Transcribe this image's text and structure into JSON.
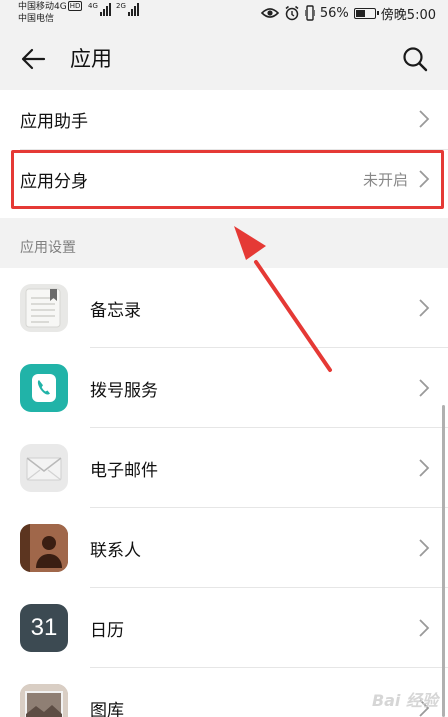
{
  "status_bar": {
    "carrier1": "中国移动4G",
    "carrier1_badge": "HD",
    "carrier2": "中国电信",
    "sig1_label": "4G",
    "sig2_label": "2G",
    "battery": "56%",
    "battery_level": 0.56,
    "time": "傍晚5:00"
  },
  "header": {
    "title": "应用"
  },
  "top_items": [
    {
      "label": "应用助手"
    },
    {
      "label": "应用分身",
      "value": "未开启"
    }
  ],
  "section_title": "应用设置",
  "apps": [
    {
      "label": "备忘录",
      "icon": "notepad-icon"
    },
    {
      "label": "拨号服务",
      "icon": "phone-icon"
    },
    {
      "label": "电子邮件",
      "icon": "mail-icon"
    },
    {
      "label": "联系人",
      "icon": "contact-icon"
    },
    {
      "label": "日历",
      "icon": "calendar-icon",
      "icon_text": "31"
    },
    {
      "label": "图库",
      "icon": "gallery-icon"
    }
  ],
  "colors": {
    "highlight": "#e53935",
    "phone": "#21b3a8",
    "background": "#f2f2f2"
  },
  "watermark": "Bai 经验"
}
